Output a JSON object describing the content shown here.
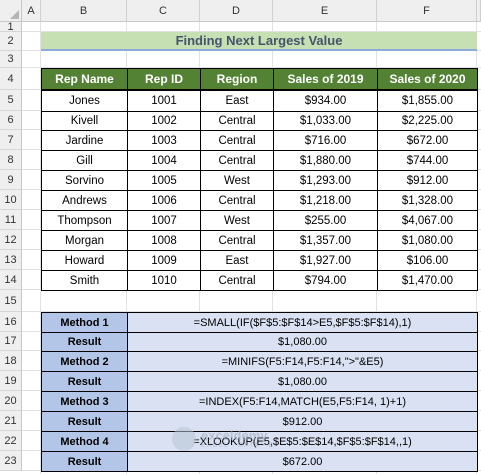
{
  "columns": [
    "A",
    "B",
    "C",
    "D",
    "E",
    "F"
  ],
  "rows": [
    "1",
    "2",
    "3",
    "4",
    "5",
    "6",
    "7",
    "8",
    "9",
    "10",
    "11",
    "12",
    "13",
    "14",
    "15",
    "16",
    "17",
    "18",
    "19",
    "20",
    "21",
    "22",
    "23"
  ],
  "title": "Finding Next Largest Value",
  "table": {
    "headers": [
      "Rep Name",
      "Rep ID",
      "Region",
      "Sales of 2019",
      "Sales of 2020"
    ],
    "rows": [
      [
        "Jones",
        "1001",
        "East",
        "$934.00",
        "$1,855.00"
      ],
      [
        "Kivell",
        "1002",
        "Central",
        "$1,033.00",
        "$2,225.00"
      ],
      [
        "Jardine",
        "1003",
        "Central",
        "$716.00",
        "$672.00"
      ],
      [
        "Gill",
        "1004",
        "Central",
        "$1,880.00",
        "$744.00"
      ],
      [
        "Sorvino",
        "1005",
        "West",
        "$1,293.00",
        "$912.00"
      ],
      [
        "Andrews",
        "1006",
        "Central",
        "$1,218.00",
        "$1,328.00"
      ],
      [
        "Thompson",
        "1007",
        "West",
        "$255.00",
        "$4,067.00"
      ],
      [
        "Morgan",
        "1008",
        "Central",
        "$1,357.00",
        "$1,080.00"
      ],
      [
        "Howard",
        "1009",
        "East",
        "$1,927.00",
        "$106.00"
      ],
      [
        "Smith",
        "1010",
        "Central",
        "$794.00",
        "$1,470.00"
      ]
    ]
  },
  "methods": [
    {
      "label": "Method 1",
      "value": "=SMALL(IF($F$5:$F$14>E5,$F$5:$F$14),1)"
    },
    {
      "label": "Result",
      "value": "$1,080.00"
    },
    {
      "label": "Method 2",
      "value": "=MINIFS(F5:F14,F5:F14,\">\"&E5)"
    },
    {
      "label": "Result",
      "value": "$1,080.00"
    },
    {
      "label": "Method 3",
      "value": "=INDEX(F5:F14,MATCH(E5,F5:F14, 1)+1)"
    },
    {
      "label": "Result",
      "value": "$912.00"
    },
    {
      "label": "Method 4",
      "value": "=XLOOKUP(E5,$E$5:$E$14,$F$5:$F$14,,1)"
    },
    {
      "label": "Result",
      "value": "$672.00"
    }
  ],
  "watermark": {
    "name": "exceldemy",
    "sub": "EXCEL · DATA · BI"
  },
  "colors": {
    "header_fill": "#548235",
    "title_fill": "#c6e0b4",
    "method_label_fill": "#b4c6e7",
    "method_value_fill": "#d9e1f2"
  }
}
